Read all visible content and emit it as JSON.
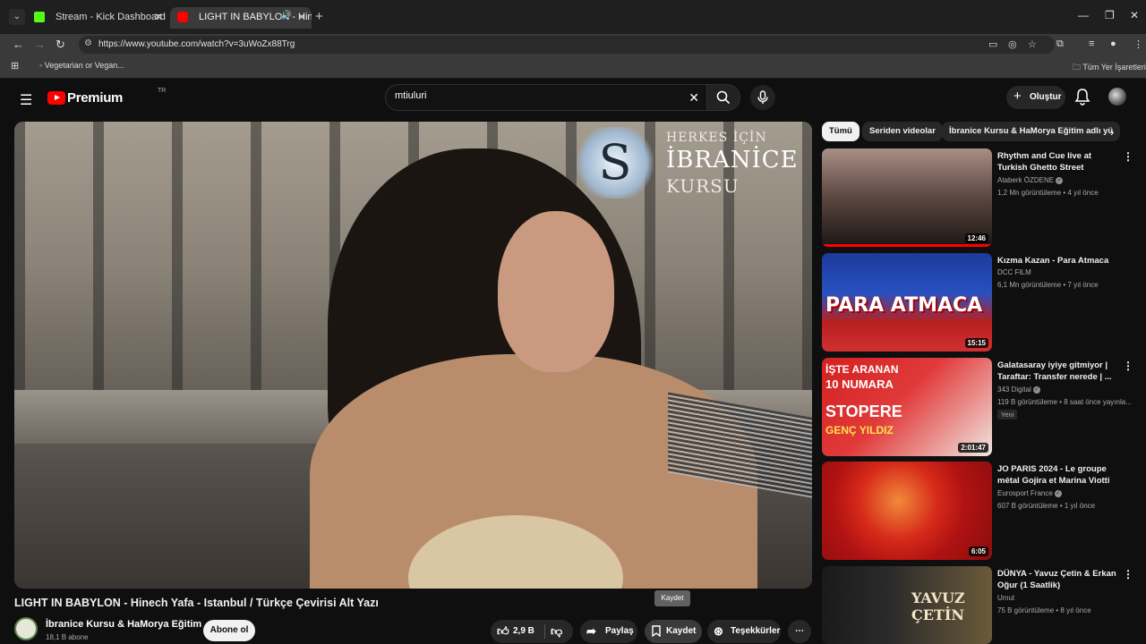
{
  "browser": {
    "tabs": [
      {
        "title": "Stream - Kick Dashboard"
      },
      {
        "title": "LIGHT IN BABYLON - Hinec"
      }
    ],
    "url": "https://www.youtube.com/watch?v=3uWoZx88Trg",
    "bookmark": "Vegetarian or Vegan...",
    "all_bookmarks": "Tüm Yer İşaretleri"
  },
  "header": {
    "logo": "Premium",
    "logo_region": "TR",
    "search_value": "mtiuluri",
    "create_label": "Oluştur"
  },
  "player": {
    "watermark_line1": "HERKES İÇİN",
    "watermark_line2": "İBRANİCE",
    "watermark_line3": "KURSU"
  },
  "video": {
    "title": "LIGHT IN BABYLON - Hinech Yafa - Istanbul / Türkçe Çevirisi Alt Yazı",
    "channel": "İbranice Kursu & HaMorya Eğitim",
    "subscribers": "18,1 B abone",
    "subscribe_label": "Abone ol",
    "likes": "2,9 B",
    "share_label": "Paylaş",
    "save_label": "Kaydet",
    "thanks_label": "Teşekkürler",
    "tooltip": "Kaydet"
  },
  "chips": [
    "Tümü",
    "Seriden videolar",
    "İbranice Kursu & HaMorya Eğitim adlı yü"
  ],
  "recommendations": [
    {
      "title": "Rhythm and Cue live at Turkish Ghetto Street",
      "channel": "Ataberk ÖZDENE",
      "meta": "1,2 Mn görüntüleme • 4 yıl önce",
      "duration": "12:46"
    },
    {
      "title": "Kızma Kazan - Para Atmaca",
      "channel": "DCC FILM",
      "meta": "6,1 Mn görüntüleme • 7 yıl önce",
      "duration": "15:15",
      "thumb_text": "PARA ATMACA"
    },
    {
      "title": "Galatasaray iyiye gitmiyor | Taraftar: Transfer nerede | ...",
      "channel": "343 Digital",
      "meta": "119 B görüntüleme • 8 saat önce yayınla...",
      "badge": "Yeni",
      "duration": "2:01:47",
      "thumb_l1": "İŞTE ARANAN",
      "thumb_l2": "10 NUMARA",
      "thumb_l3": "STOPERE",
      "thumb_l4": "GENÇ YILDIZ"
    },
    {
      "title": "JO PARIS 2024 - Le groupe métal Gojira et Marina Viotti ...",
      "channel": "Eurosport France",
      "meta": "607 B görüntüleme • 1 yıl önce",
      "duration": "6:05"
    },
    {
      "title": "DÜNYA - Yavuz Çetin & Erkan Oğur (1 Saatlik)",
      "channel": "Umut",
      "meta": "75 B görüntüleme • 8 yıl önce",
      "thumb_text": "YAVUZ ÇETİN"
    }
  ]
}
